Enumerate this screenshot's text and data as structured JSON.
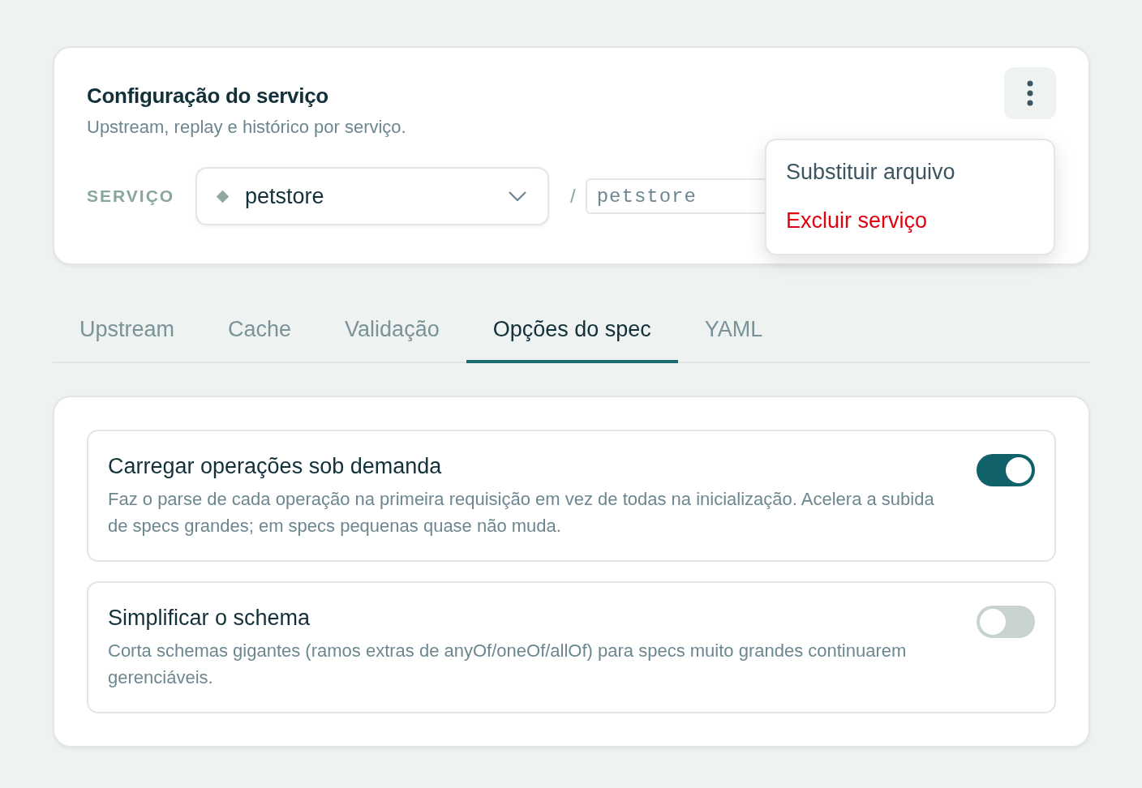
{
  "service_card": {
    "title": "Configuração do serviço",
    "subtitle": "Upstream, replay e histórico por serviço.",
    "service_label": "SERVIÇO",
    "service_select": {
      "value": "petstore"
    },
    "separator": "/",
    "path_field": {
      "value": "petstore"
    },
    "menu_open": true,
    "menu": [
      {
        "label": "Substituir arquivo",
        "kind": "normal"
      },
      {
        "label": "Excluir serviço",
        "kind": "danger"
      }
    ]
  },
  "tabs": [
    {
      "label": "Upstream",
      "selected": false
    },
    {
      "label": "Cache",
      "selected": false
    },
    {
      "label": "Validação",
      "selected": false
    },
    {
      "label": "Opções do spec",
      "selected": true
    },
    {
      "label": "YAML",
      "selected": false
    }
  ],
  "options": [
    {
      "title": "Carregar operações sob demanda",
      "description": "Faz o parse de cada operação na primeira requisição em vez de todas na inicialização. Acelera a subida de specs grandes; em specs pequenas quase não muda.",
      "on": true
    },
    {
      "title": "Simplificar o schema",
      "description": "Corta schemas gigantes (ramos extras de anyOf/oneOf/allOf) para specs muito grandes continuarem gerenciáveis.",
      "on": false
    }
  ]
}
